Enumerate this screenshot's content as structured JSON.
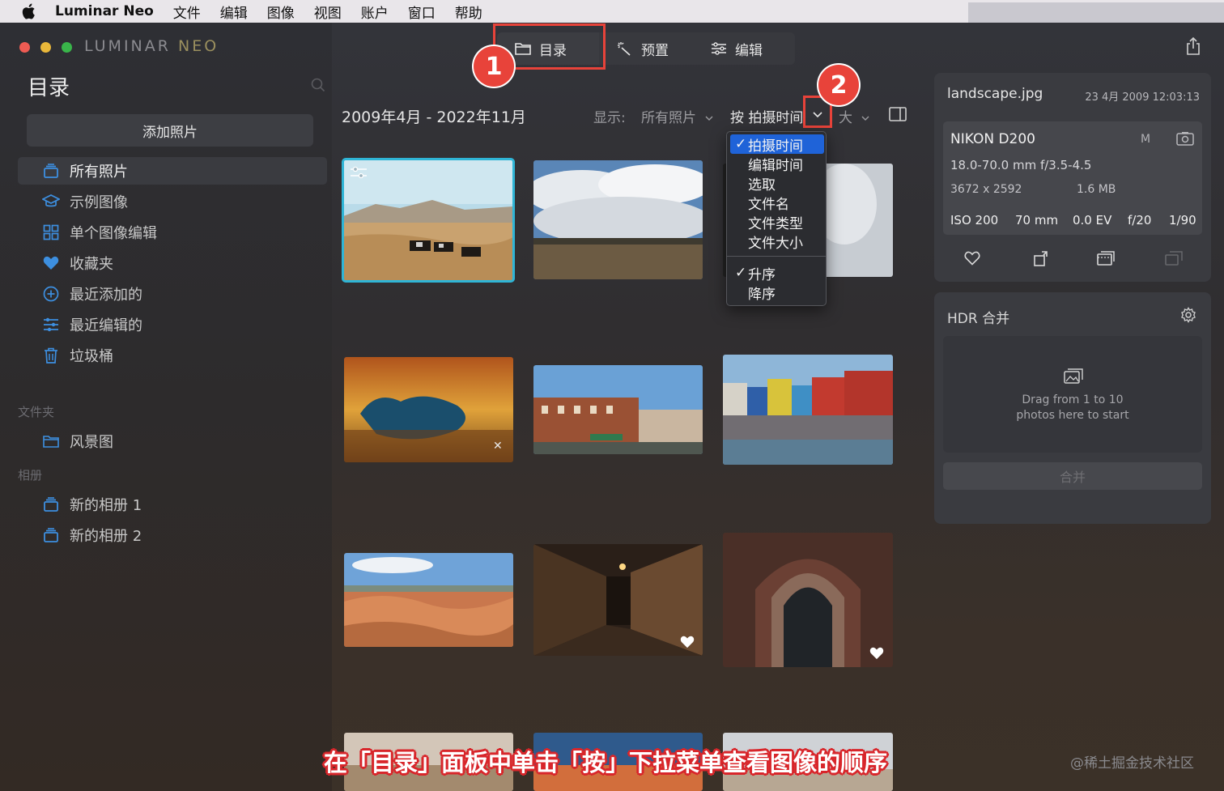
{
  "menubar": {
    "app": "Luminar Neo",
    "items": [
      "文件",
      "编辑",
      "图像",
      "视图",
      "账户",
      "窗口",
      "帮助"
    ]
  },
  "window": {
    "logo_main": "LUMINAR",
    "logo_accent": "NEO"
  },
  "sidebar": {
    "title": "目录",
    "add_button": "添加照片",
    "items": [
      {
        "label": "所有照片",
        "icon": "stack-icon",
        "active": true
      },
      {
        "label": "示例图像",
        "icon": "graduation-cap-icon"
      },
      {
        "label": "单个图像编辑",
        "icon": "grid-icon"
      },
      {
        "label": "收藏夹",
        "icon": "heart-icon"
      },
      {
        "label": "最近添加的",
        "icon": "plus-circle-icon"
      },
      {
        "label": "最近编辑的",
        "icon": "sliders-icon"
      },
      {
        "label": "垃圾桶",
        "icon": "trash-icon"
      }
    ],
    "folders_label": "文件夹",
    "folders": [
      {
        "label": "风景图",
        "icon": "folder-icon"
      }
    ],
    "albums_label": "相册",
    "albums": [
      {
        "label": "新的相册 1",
        "icon": "stack-icon"
      },
      {
        "label": "新的相册 2",
        "icon": "stack-icon"
      }
    ]
  },
  "tabs": [
    {
      "label": "目录",
      "icon": "folder-icon"
    },
    {
      "label": "预置",
      "icon": "magic-wand-icon"
    },
    {
      "label": "编辑",
      "icon": "sliders-icon"
    }
  ],
  "toolbar": {
    "date_range": "2009年4月 - 2022年11月",
    "show_label": "显示:",
    "show_value": "所有照片",
    "sort_label": "按 拍摄时间",
    "size_label": "大"
  },
  "sort_menu": {
    "fields": [
      "拍摄时间",
      "编辑时间",
      "选取",
      "文件名",
      "文件类型",
      "文件大小"
    ],
    "selected_field": "拍摄时间",
    "orders": [
      "升序",
      "降序"
    ],
    "selected_order": "升序"
  },
  "callouts": [
    "1",
    "2"
  ],
  "info": {
    "file_name": "landscape.jpg",
    "file_date": "23 4月 2009 12:03:13",
    "camera": "NIKON D200",
    "mode": "M",
    "lens": "18.0-70.0 mm f/3.5-4.5",
    "dimensions": "3672 x 2592",
    "file_size": "1.6 MB",
    "iso": "ISO 200",
    "focal": "70 mm",
    "ev": "0.0 EV",
    "aperture": "f/20",
    "shutter": "1/90"
  },
  "hdr": {
    "title": "HDR 合并",
    "drop_line1": "Drag from 1 to 10",
    "drop_line2": "photos here to start",
    "merge_button": "合并"
  },
  "caption": "在「目录」面板中单击「按」下拉菜单查看图像的顺序",
  "watermark": "@稀土掘金技术社区",
  "colors": {
    "accent_red": "#e8433a",
    "selection_blue": "#2fb5d6",
    "menu_highlight": "#1f63d8",
    "sidebar_icon_blue": "#3d8fe0"
  }
}
